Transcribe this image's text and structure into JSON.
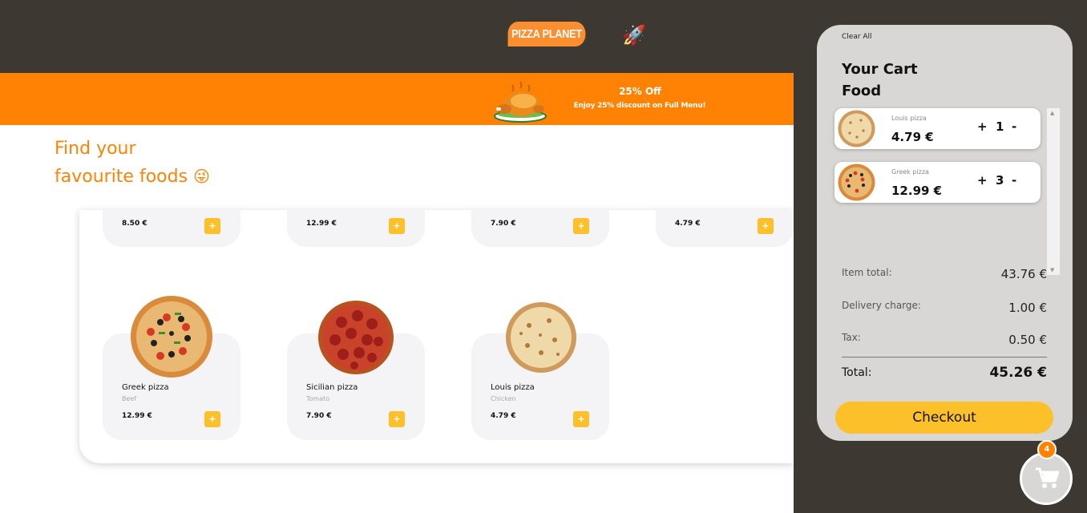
{
  "header": {
    "brand": "PIZZA PLANET",
    "rocket_icon": "🚀"
  },
  "banner": {
    "title": "25% Off",
    "subtitle": "Enjoy 25% discount on Full Menu!",
    "image_icon": "roast-chicken"
  },
  "heading": {
    "line1": "Find your",
    "line2": "favourite foods",
    "emoji": "😜"
  },
  "products_top_row": [
    {
      "price": "8.50 €"
    },
    {
      "price": "12.99 €"
    },
    {
      "price": "7.90 €"
    },
    {
      "price": "4.79 €"
    }
  ],
  "products": [
    {
      "name": "Greek pizza",
      "desc": "Beef",
      "price": "12.99 €",
      "image": "greek-pizza"
    },
    {
      "name": "Sicilian pizza",
      "desc": "Tomato",
      "price": "7.90 €",
      "image": "sicilian-pizza"
    },
    {
      "name": "Louis pizza",
      "desc": "Chicken",
      "price": "4.79 €",
      "image": "louis-pizza"
    }
  ],
  "add_label": "+",
  "cart": {
    "clear_all": "Clear All",
    "title_line1": "Your Cart",
    "title_line2": "Food",
    "items": [
      {
        "name": "Louis pizza",
        "price": "4.79 €",
        "plus": "+",
        "qty": "1",
        "minus": "-"
      },
      {
        "name": "Greek pizza",
        "price": "12.99 €",
        "plus": "+",
        "qty": "3",
        "minus": "-"
      }
    ],
    "item_total_label": "Item total:",
    "item_total": "43.76 €",
    "delivery_label": "Delivery charge:",
    "delivery": "1.00 €",
    "tax_label": "Tax:",
    "tax": "0.50 €",
    "total_label": "Total:",
    "total": "45.26 €",
    "checkout": "Checkout",
    "badge_count": "4"
  },
  "colors": {
    "accent_orange": "#ff8204",
    "button_yellow": "#fcc02a",
    "dark_bg": "#3e3833",
    "cart_bg": "#d9d7d5"
  }
}
